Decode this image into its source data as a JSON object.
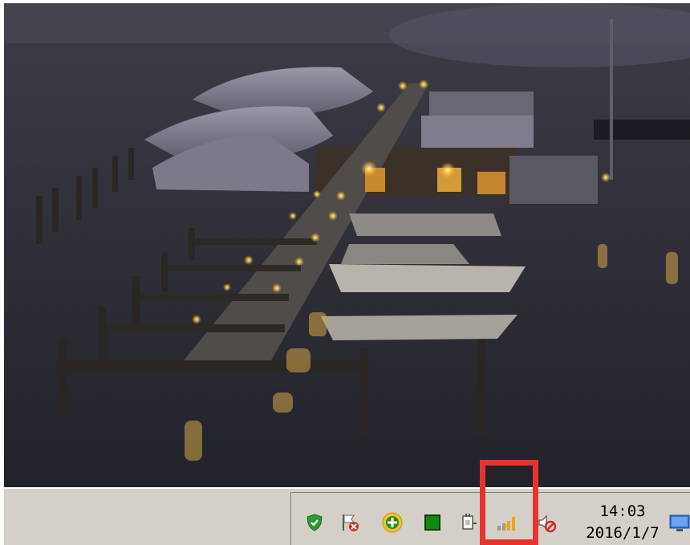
{
  "taskbar": {
    "tray_icons": [
      {
        "icon": "shield-check-icon",
        "color": "#2e9b2e"
      },
      {
        "icon": "flag-blocked-icon",
        "color": "#d42a2a"
      },
      {
        "icon": "green-plus-icon",
        "color": "#1e8f1e"
      },
      {
        "icon": "green-square-icon",
        "color": "#118811"
      },
      {
        "icon": "safely-remove-hardware-icon",
        "color": "#6a6a6a"
      },
      {
        "icon": "signal-strength-icon",
        "color": "#e6a817"
      },
      {
        "icon": "volume-muted-icon",
        "color": "#d42a2a"
      },
      {
        "icon": "show-desktop-icon",
        "color": "#2f6fd6"
      }
    ],
    "clock": {
      "time": "14:03",
      "date": "2016/1/7"
    }
  },
  "highlight": {
    "target": "signal-strength-icon",
    "color": "#e8322f"
  },
  "wallpaper": {
    "subject": "marina-at-night"
  }
}
